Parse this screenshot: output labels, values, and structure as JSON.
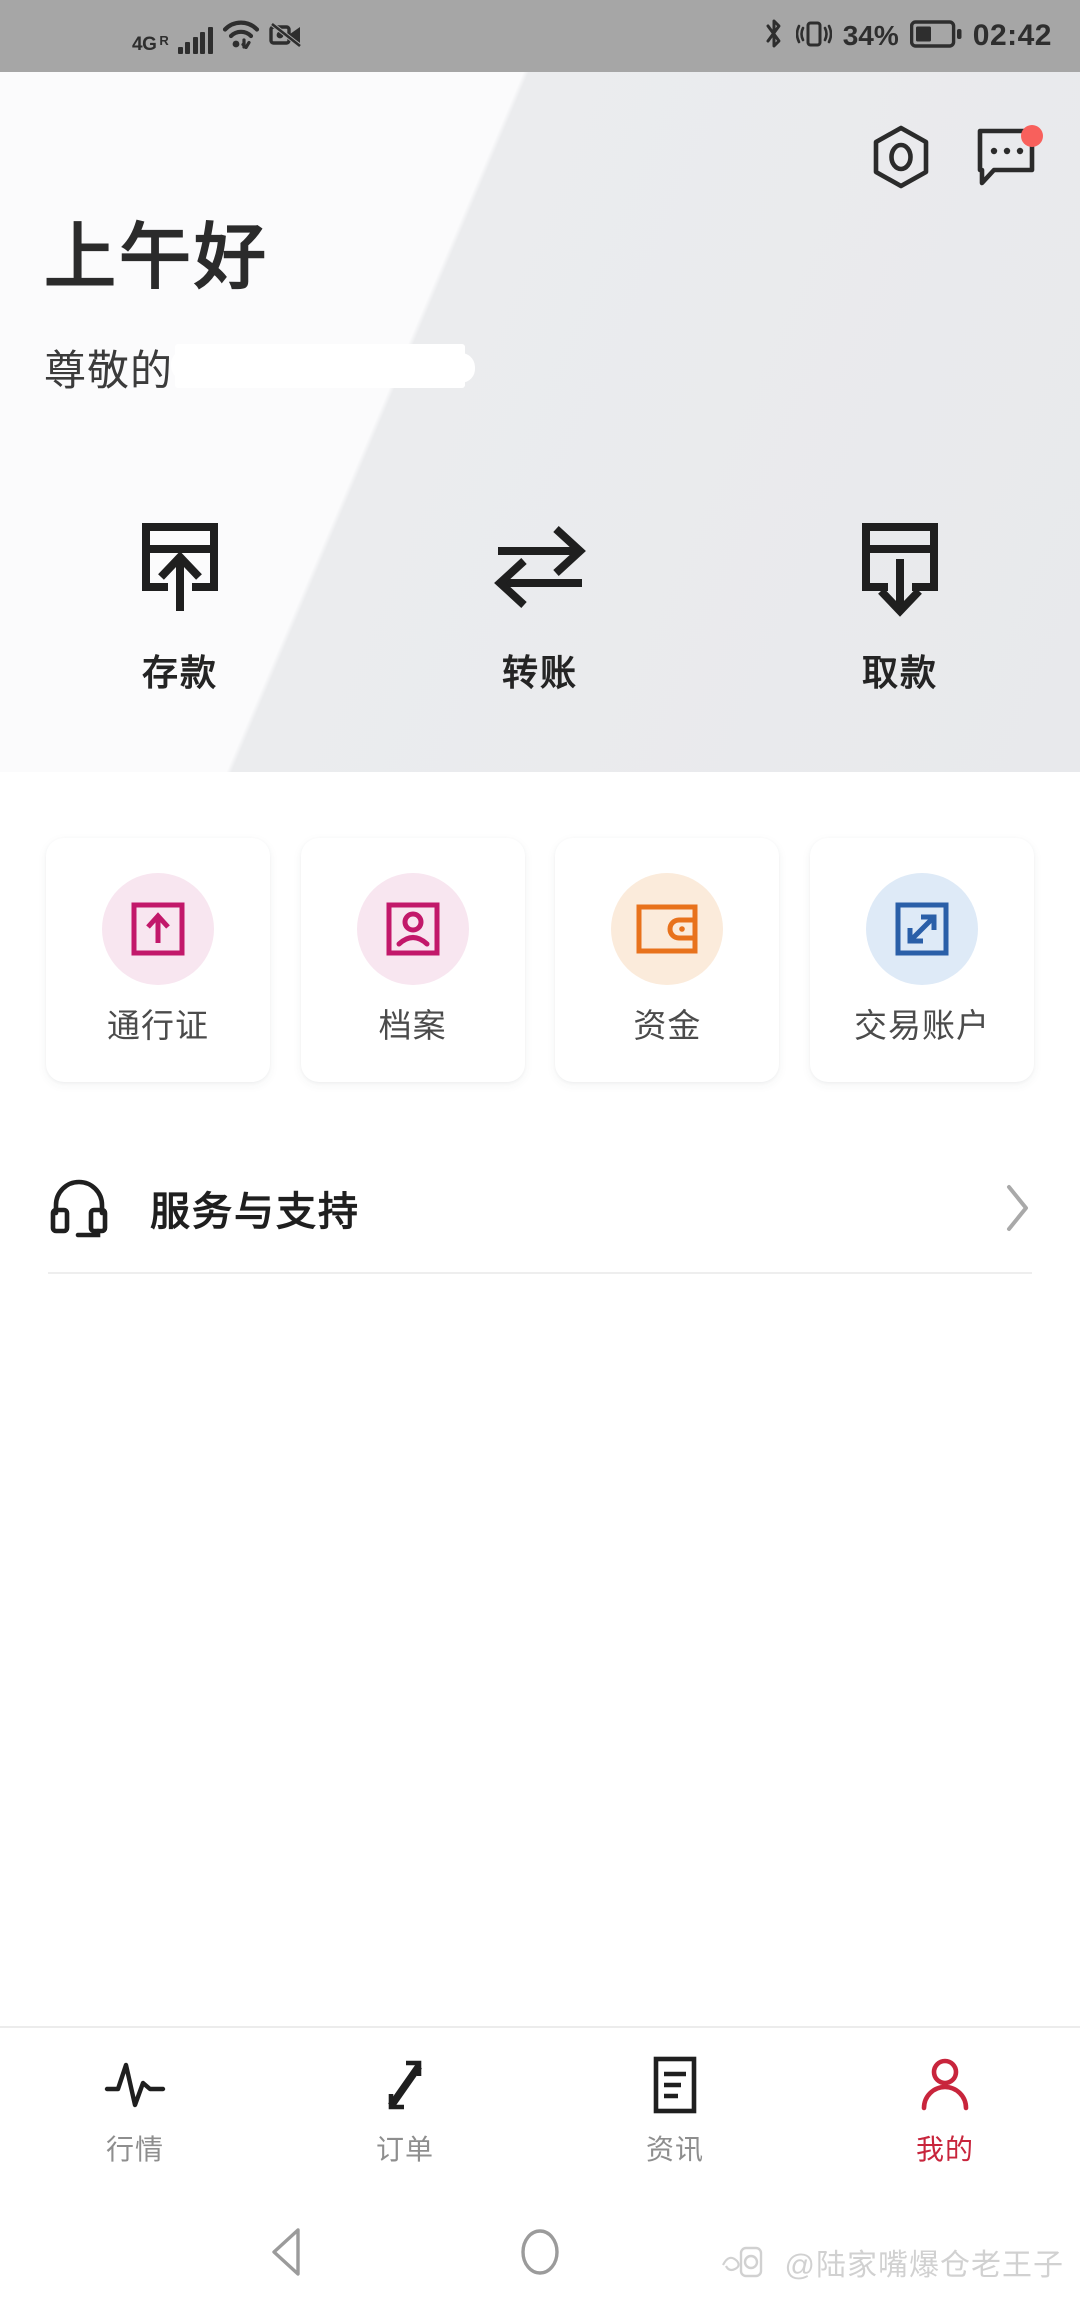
{
  "status_bar": {
    "network_type": "4G",
    "roaming": "R",
    "battery_percent": "34%",
    "clock": "02:42",
    "icons": [
      "signal-bars-icon",
      "wifi-icon",
      "camera-off-icon",
      "bluetooth-icon",
      "vibrate-icon",
      "battery-icon"
    ]
  },
  "header": {
    "greeting": "上午好",
    "salutation_prefix": "尊敬的",
    "salutation_name_redacted": "",
    "settings_icon": "hexagon-gear-icon",
    "message_icon": "message-bubble-icon",
    "message_badge": true
  },
  "quick_actions": [
    {
      "label": "存款",
      "icon": "deposit-arrow-up-icon"
    },
    {
      "label": "转账",
      "icon": "transfer-arrows-icon"
    },
    {
      "label": "取款",
      "icon": "withdraw-arrow-down-icon"
    }
  ],
  "tiles": [
    {
      "label": "通行证",
      "icon": "passport-arrow-up-icon",
      "color": "#C2186A",
      "bg": "#F8E6F0"
    },
    {
      "label": "档案",
      "icon": "profile-person-icon",
      "color": "#C2186A",
      "bg": "#F8E6F0"
    },
    {
      "label": "资金",
      "icon": "wallet-icon",
      "color": "#E8721C",
      "bg": "#FBEBDB"
    },
    {
      "label": "交易账户",
      "icon": "exchange-arrows-icon",
      "color": "#2A5FA8",
      "bg": "#DEEAF7"
    }
  ],
  "service_row": {
    "label": "服务与支持",
    "icon": "headset-icon",
    "chevron": "chevron-right-icon"
  },
  "bottom_nav": {
    "active_color": "#C8253C",
    "inactive_color": "#8E8E8E",
    "items": [
      {
        "label": "行情",
        "icon": "pulse-chart-icon",
        "active": false
      },
      {
        "label": "订单",
        "icon": "orders-arrows-icon",
        "active": false
      },
      {
        "label": "资讯",
        "icon": "news-document-icon",
        "active": false
      },
      {
        "label": "我的",
        "icon": "person-icon",
        "active": true
      }
    ]
  },
  "android_nav": {
    "back_icon": "triangle-back-icon",
    "home_icon": "circle-home-icon"
  },
  "watermark": {
    "text": "@陆家嘴爆仓老王子",
    "logo_icon": "app-logo-icon"
  }
}
